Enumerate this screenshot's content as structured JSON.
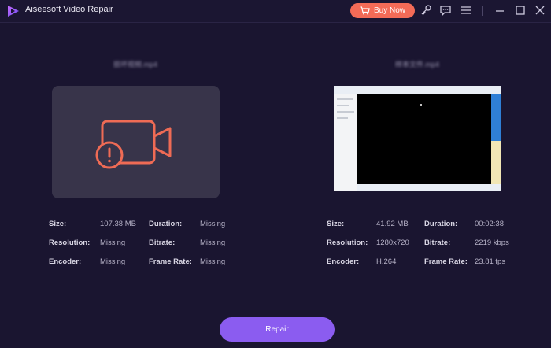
{
  "app": {
    "title": "Aiseesoft Video Repair",
    "buy_label": "Buy Now"
  },
  "colors": {
    "background": "#1a1530",
    "accent_buy": "#f36b57",
    "accent_repair": "#8b5cf0",
    "warning_icon": "#ef6b55"
  },
  "left": {
    "filename": "损坏视频.mp4",
    "icon": "video-camera-error-icon",
    "size_label": "Size:",
    "size_value": "107.38 MB",
    "duration_label": "Duration:",
    "duration_value": "Missing",
    "resolution_label": "Resolution:",
    "resolution_value": "Missing",
    "bitrate_label": "Bitrate:",
    "bitrate_value": "Missing",
    "encoder_label": "Encoder:",
    "encoder_value": "Missing",
    "framerate_label": "Frame Rate:",
    "framerate_value": "Missing"
  },
  "right": {
    "filename": "样本文件.mp4",
    "size_label": "Size:",
    "size_value": "41.92 MB",
    "duration_label": "Duration:",
    "duration_value": "00:02:38",
    "resolution_label": "Resolution:",
    "resolution_value": "1280x720",
    "bitrate_label": "Bitrate:",
    "bitrate_value": "2219 kbps",
    "encoder_label": "Encoder:",
    "encoder_value": "H.264",
    "framerate_label": "Frame Rate:",
    "framerate_value": "23.81 fps"
  },
  "repair_label": "Repair"
}
